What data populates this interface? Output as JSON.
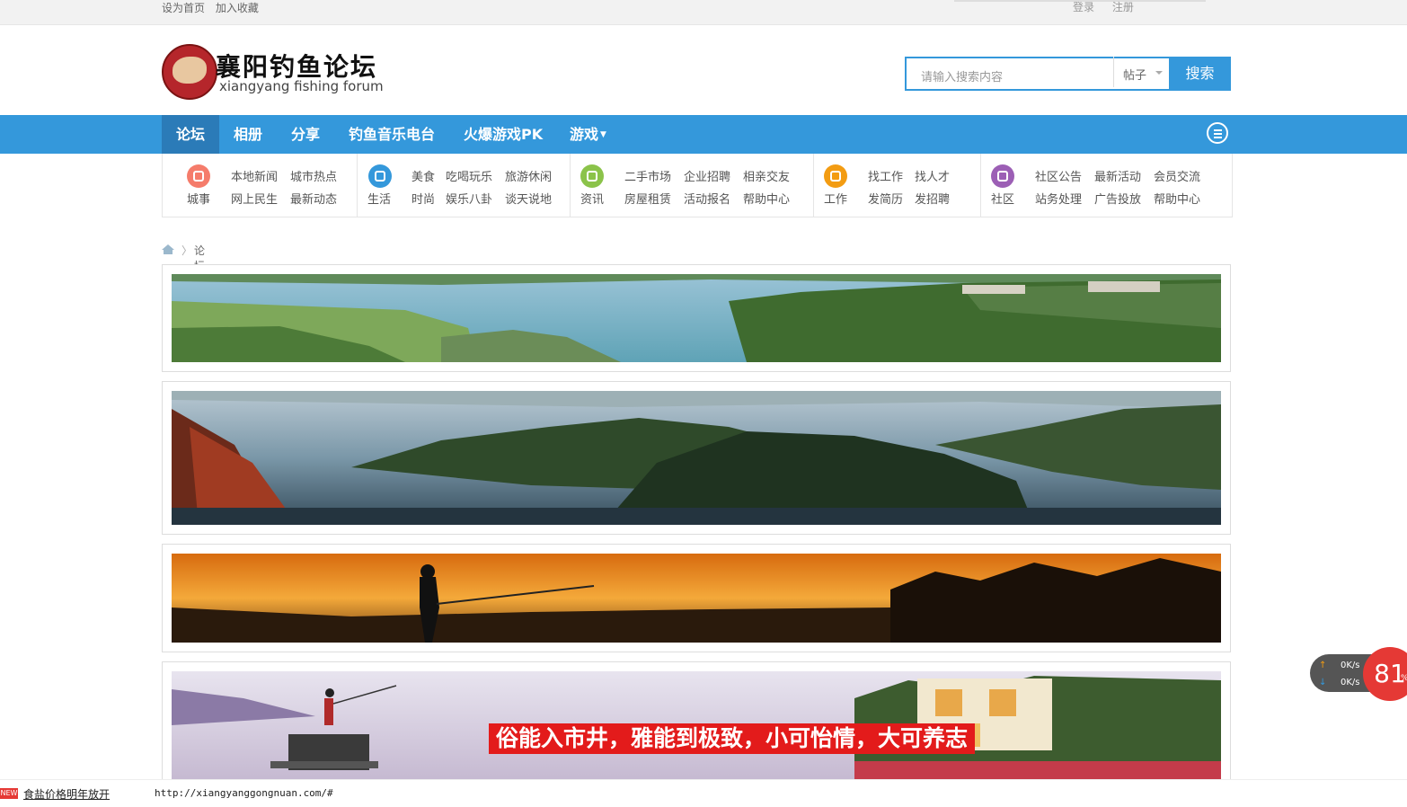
{
  "topbar": {
    "set_home": "设为首页",
    "add_fav": "加入收藏",
    "login": "登录",
    "register": "注册"
  },
  "logo": {
    "title": "襄阳钓鱼论坛",
    "subtitle": "xiangyang fishing forum"
  },
  "search": {
    "placeholder": "请输入搜索内容",
    "type": "帖子",
    "button": "搜索"
  },
  "nav": {
    "items": [
      "论坛",
      "相册",
      "分享",
      "钓鱼音乐电台",
      "火爆游戏PK",
      "游戏"
    ]
  },
  "quick": [
    {
      "label": "城事",
      "links": [
        "本地新闻",
        "城市热点",
        "网上民生",
        "最新动态"
      ]
    },
    {
      "label": "生活",
      "links": [
        "美食",
        "吃喝玩乐",
        "旅游休闲",
        "时尚",
        "娱乐八卦",
        "谈天说地"
      ]
    },
    {
      "label": "资讯",
      "links": [
        "二手市场",
        "企业招聘",
        "相亲交友",
        "房屋租赁",
        "活动报名",
        "帮助中心"
      ]
    },
    {
      "label": "工作",
      "links": [
        "找工作",
        "找人才",
        "发简历",
        "发招聘"
      ]
    },
    {
      "label": "社区",
      "links": [
        "社区公告",
        "最新活动",
        "会员交流",
        "站务处理",
        "广告投放",
        "帮助中心"
      ]
    }
  ],
  "breadcrumb": {
    "sep": "〉",
    "current": "论坛"
  },
  "banner4": {
    "slogan": "俗能入市井，雅能到极致，小可怡情，大可养志"
  },
  "speed": {
    "up": "0",
    "down": "0",
    "unit": "K/s",
    "percent": "81",
    "pct_sign": "%"
  },
  "status": {
    "new_tag": "NEW",
    "news": "食盐价格明年放开",
    "url": "http://xiangyanggongnuan.com/#"
  },
  "colors": {
    "nav_blue": "#3498db",
    "nav_active": "#2b7bb8",
    "accent_red": "#e31b1b"
  }
}
